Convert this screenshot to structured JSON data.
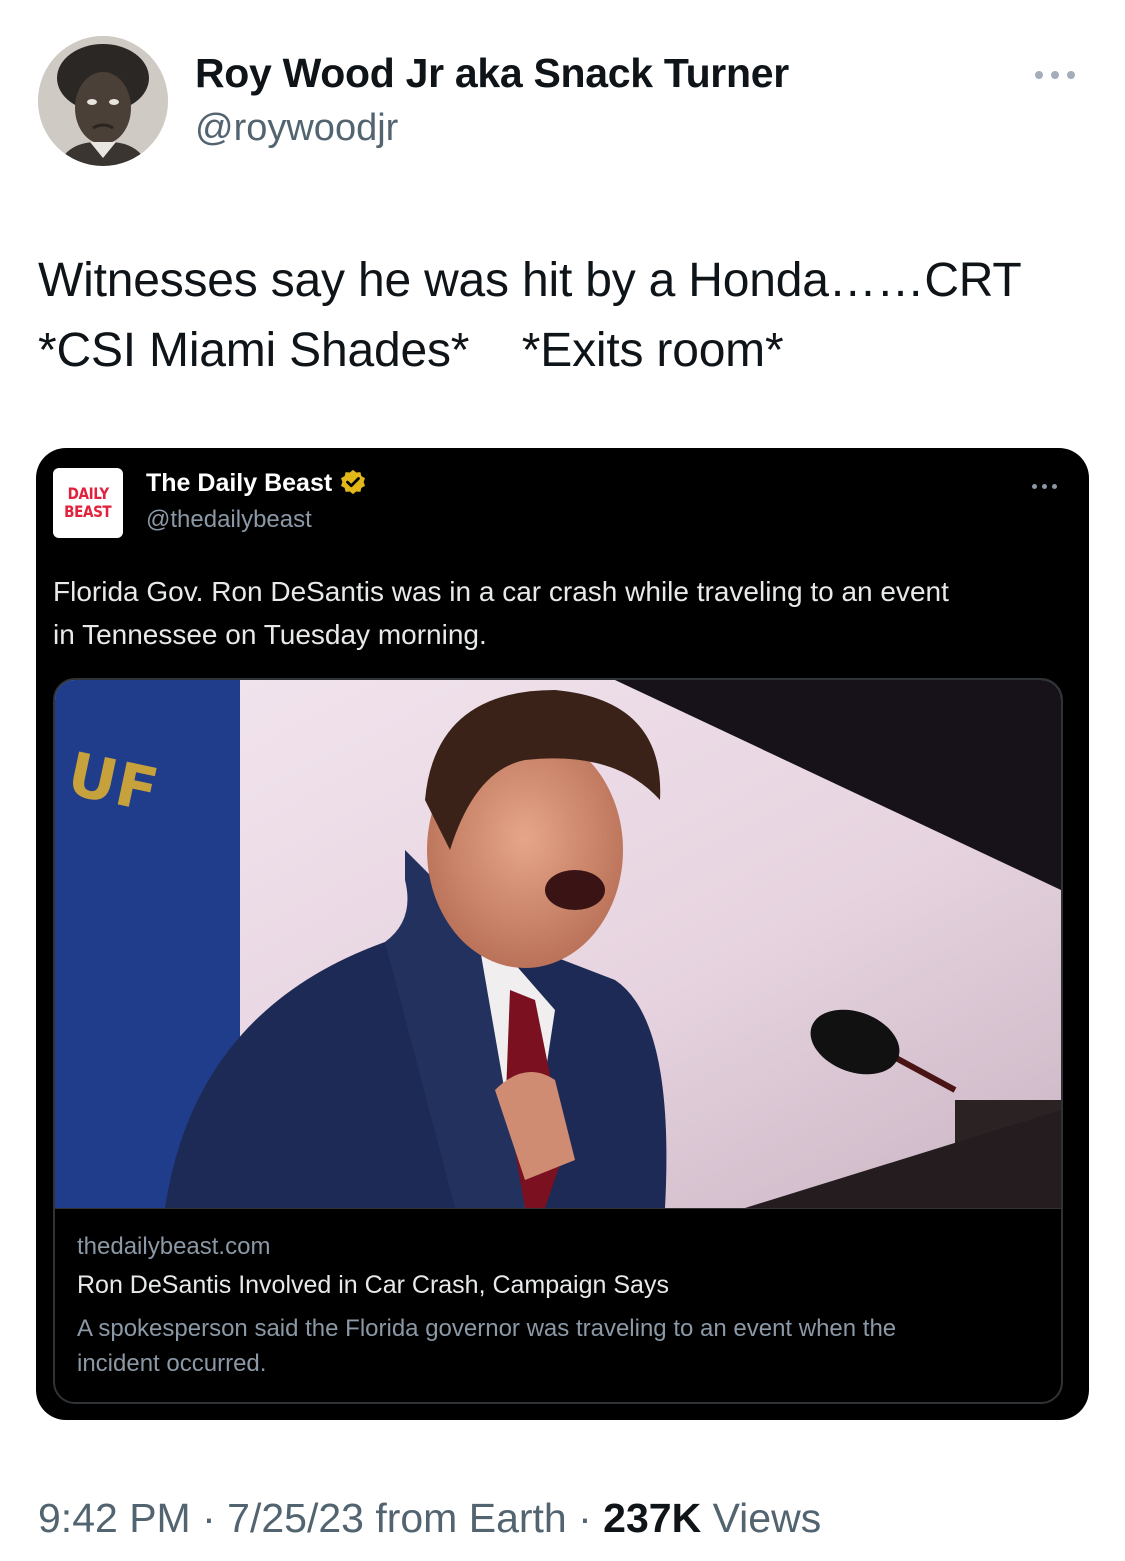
{
  "author": {
    "display_name": "Roy Wood Jr aka Snack Turner",
    "handle": "@roywoodjr"
  },
  "tweet": {
    "text_lines": [
      "Witnesses say he was hit by a Honda……CRT",
      "*CSI Miami Shades*    *Exits room*"
    ]
  },
  "quoted_tweet": {
    "avatar_logo_lines": [
      "DAILY",
      "BEAST"
    ],
    "display_name": "The Daily Beast",
    "handle": "@thedailybeast",
    "verified_badge_color": "#e2b719",
    "text_lines": [
      "Florida Gov. Ron DeSantis was in a car crash while traveling to an event",
      "in Tennessee on Tuesday morning."
    ],
    "link_card": {
      "domain": "thedailybeast.com",
      "title": "Ron DeSantis Involved in Car Crash, Campaign Says",
      "description_lines": [
        "A spokesperson said the Florida governor was traveling to an event when the",
        "incident occurred."
      ]
    }
  },
  "footer": {
    "time": "9:42 PM",
    "separator": " · ",
    "date": "7/25/23",
    "source": " from Earth",
    "views_count": "237K",
    "views_label": " Views"
  },
  "colors": {
    "secondary_text": "#536471",
    "quote_background": "#000000",
    "daily_beast_red": "#e2223c"
  }
}
